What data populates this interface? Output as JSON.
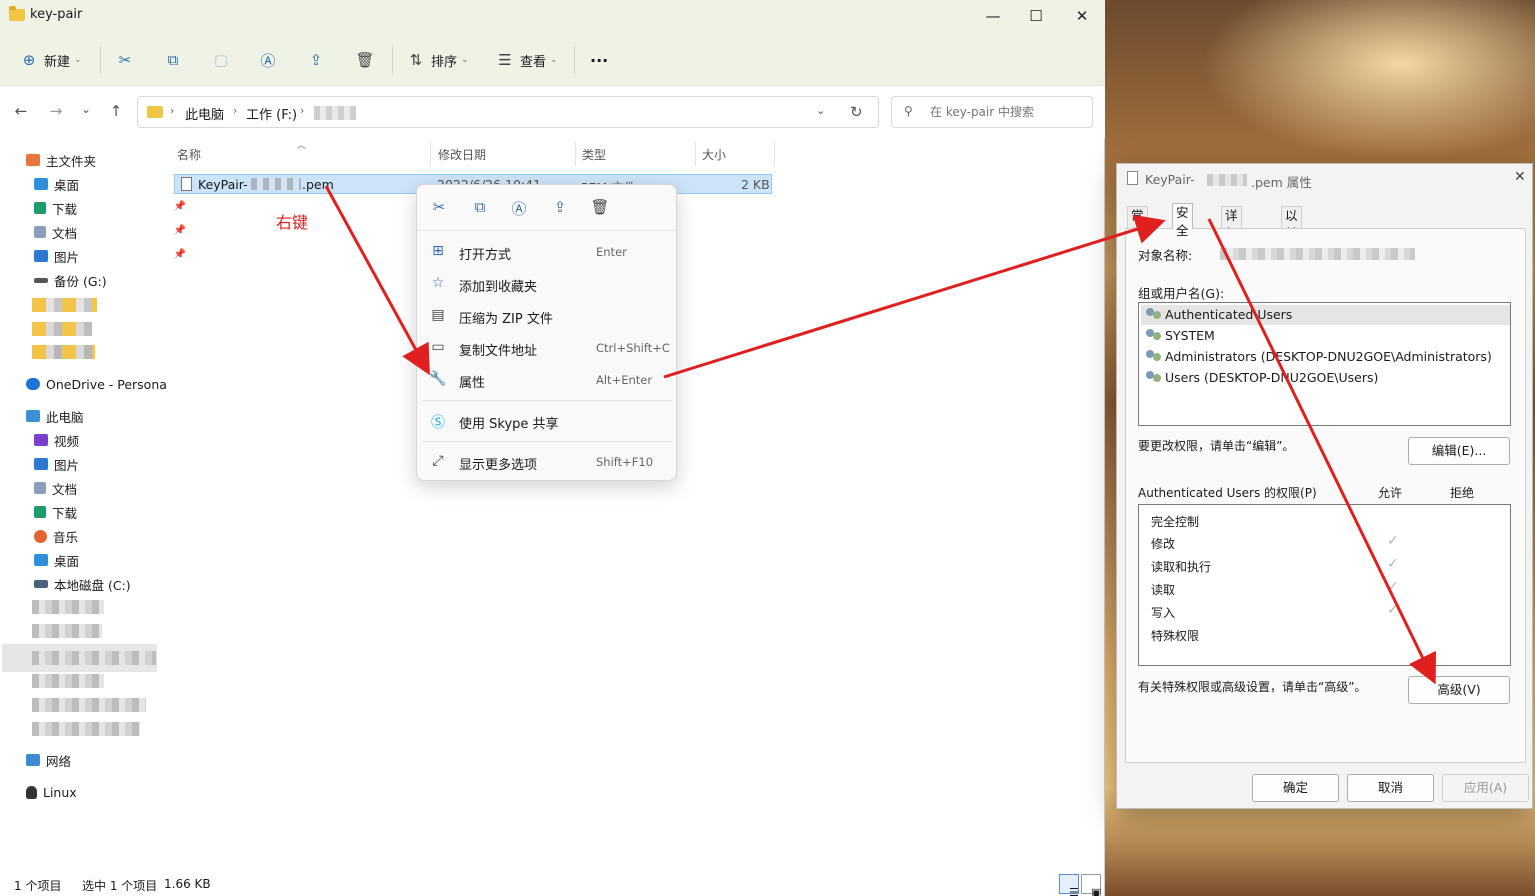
{
  "window": {
    "title": "key-pair",
    "minimize": "—",
    "maximize": "☐",
    "close": "✕"
  },
  "toolbar": {
    "new_label": "新建",
    "sort_label": "排序",
    "view_label": "查看",
    "more_label": "···"
  },
  "nav": {
    "back": "←",
    "forward": "→",
    "recent": "⌄",
    "up": "↑",
    "breadcrumbs": [
      "此电脑",
      "工作 (F:)"
    ],
    "search_placeholder": "在 key-pair 中搜索"
  },
  "sidebar": {
    "items": [
      {
        "label": "主文件夹"
      },
      {
        "label": "桌面"
      },
      {
        "label": "下载"
      },
      {
        "label": "文档"
      },
      {
        "label": "图片"
      },
      {
        "label": "备份 (G:)"
      },
      {
        "label": "OneDrive - Persona"
      },
      {
        "label": "此电脑"
      },
      {
        "label": "视频"
      },
      {
        "label": "图片"
      },
      {
        "label": "文档"
      },
      {
        "label": "下载"
      },
      {
        "label": "音乐"
      },
      {
        "label": "桌面"
      },
      {
        "label": "本地磁盘 (C:)"
      },
      {
        "label": "网络"
      },
      {
        "label": "Linux"
      }
    ]
  },
  "filelist": {
    "columns": [
      "名称",
      "修改日期",
      "类型",
      "大小"
    ],
    "rows": [
      {
        "name_prefix": "KeyPair-",
        "name_suffix": ".pem",
        "date": "2022/6/26 10:41",
        "type": "PEM 文件",
        "size": "2 KB"
      }
    ]
  },
  "annotation": {
    "right_click": "右键"
  },
  "context_menu": {
    "items": [
      {
        "label": "打开方式",
        "key": "Enter"
      },
      {
        "label": "添加到收藏夹",
        "key": ""
      },
      {
        "label": "压缩为 ZIP 文件",
        "key": ""
      },
      {
        "label": "复制文件地址",
        "key": "Ctrl+Shift+C"
      },
      {
        "label": "属性",
        "key": "Alt+Enter"
      },
      {
        "label": "使用 Skype 共享",
        "key": ""
      },
      {
        "label": "显示更多选项",
        "key": "Shift+F10"
      }
    ]
  },
  "status": {
    "count": "1 个项目",
    "selected": "选中 1 个项目",
    "size": "1.66 KB"
  },
  "dialog": {
    "title_prefix": "KeyPair-",
    "title_suffix": ".pem 属性",
    "tabs": [
      "常规",
      "安全",
      "详细信息",
      "以前的版本"
    ],
    "object_label": "对象名称:",
    "group_label": "组或用户名(G):",
    "users": [
      "Authenticated Users",
      "SYSTEM",
      "Administrators (DESKTOP-DNU2GOE\\Administrators)",
      "Users (DESKTOP-DNU2GOE\\Users)"
    ],
    "edit_hint": "要更改权限，请单击“编辑”。",
    "edit_button": "编辑(E)...",
    "perm_header": "Authenticated Users 的权限(P)",
    "allow_header": "允许",
    "deny_header": "拒绝",
    "permissions": [
      {
        "name": "完全控制",
        "allow": false
      },
      {
        "name": "修改",
        "allow": true
      },
      {
        "name": "读取和执行",
        "allow": true
      },
      {
        "name": "读取",
        "allow": true
      },
      {
        "name": "写入",
        "allow": true
      },
      {
        "name": "特殊权限",
        "allow": false
      }
    ],
    "advanced_hint": "有关特殊权限或高级设置，请单击“高级”。",
    "advanced_button": "高级(V)",
    "ok_button": "确定",
    "cancel_button": "取消",
    "apply_button": "应用(A)"
  },
  "colors": {
    "accent": "#2b6cb0",
    "annotation": "#e01f1f",
    "selection": "#cce4f7"
  }
}
